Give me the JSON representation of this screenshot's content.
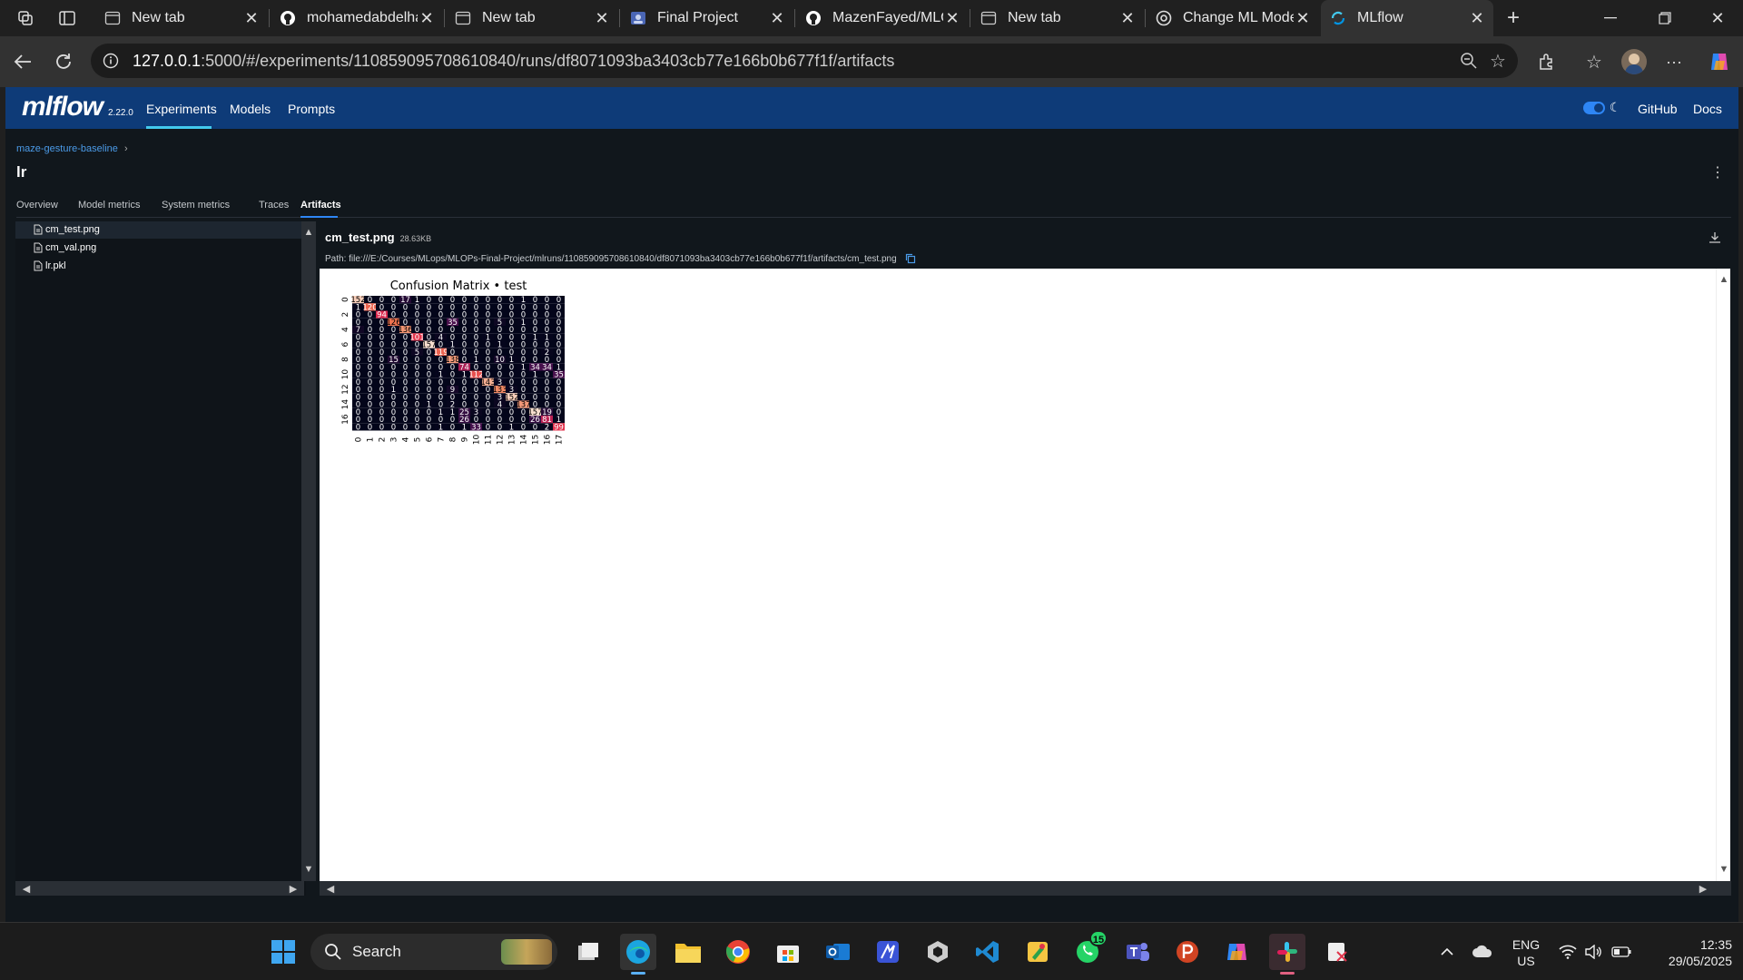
{
  "browser": {
    "tabs": [
      {
        "label": "New tab",
        "icon": "newtab-icon"
      },
      {
        "label": "mohamedabdelhamid",
        "icon": "github-icon"
      },
      {
        "label": "New tab",
        "icon": "newtab-icon"
      },
      {
        "label": "Final Project",
        "icon": "drive-icon"
      },
      {
        "label": "MazenFayed/MLOps",
        "icon": "github-icon"
      },
      {
        "label": "New tab",
        "icon": "newtab-icon"
      },
      {
        "label": "Change ML Model",
        "icon": "chatgpt-icon"
      },
      {
        "label": "MLflow",
        "icon": "mlflow-icon",
        "active": true
      }
    ],
    "url_host": "127.0.0.1",
    "url_rest": ":5000/#/experiments/110859095708610840/runs/df8071093ba3403cb77e166b0b677f1f/artifacts"
  },
  "header": {
    "logo": "mlflow",
    "version": "2.22.0",
    "nav": [
      "Experiments",
      "Models",
      "Prompts"
    ],
    "active_nav": "Experiments",
    "right_links": [
      "GitHub",
      "Docs"
    ],
    "accent": "#0e3b78"
  },
  "run": {
    "breadcrumb": "maze-gesture-baseline",
    "breadcrumb_sep": "›",
    "title": "lr",
    "tabs": [
      "Overview",
      "Model metrics",
      "System metrics",
      "Traces",
      "Artifacts"
    ],
    "active_tab": "Artifacts"
  },
  "artifacts": {
    "files": [
      "cm_test.png",
      "cm_val.png",
      "lr.pkl"
    ],
    "selected": "cm_test.png",
    "selected_size": "28.63KB",
    "path": "Path: file:///E:/Courses/MLops/MLOPs-Final-Project/mlruns/110859095708610840/df8071093ba3403cb77e166b0b677f1f/artifacts/cm_test.png"
  },
  "chart_data": {
    "type": "heatmap",
    "title": "Confusion Matrix • test",
    "x_labels": [
      "0",
      "1",
      "2",
      "3",
      "4",
      "5",
      "6",
      "7",
      "8",
      "9",
      "10",
      "11",
      "12",
      "13",
      "14",
      "15",
      "16",
      "17"
    ],
    "y_tick_labels": [
      "0",
      "",
      "2",
      "",
      "4",
      "",
      "6",
      "",
      "8",
      "",
      "10",
      "",
      "12",
      "",
      "14",
      "",
      "16",
      ""
    ],
    "matrix": [
      [
        152,
        0,
        0,
        0,
        17,
        1,
        0,
        0,
        0,
        0,
        0,
        0,
        0,
        0,
        1,
        0,
        0,
        0
      ],
      [
        1,
        120,
        0,
        0,
        0,
        0,
        0,
        0,
        0,
        0,
        0,
        0,
        0,
        0,
        0,
        0,
        0,
        0
      ],
      [
        0,
        0,
        94,
        0,
        0,
        0,
        0,
        0,
        0,
        0,
        0,
        0,
        0,
        0,
        0,
        0,
        0,
        0
      ],
      [
        0,
        0,
        0,
        126,
        0,
        0,
        0,
        0,
        35,
        0,
        0,
        0,
        5,
        0,
        1,
        0,
        0,
        0
      ],
      [
        7,
        0,
        0,
        0,
        136,
        0,
        0,
        0,
        0,
        0,
        0,
        0,
        0,
        0,
        0,
        0,
        0,
        0
      ],
      [
        0,
        0,
        0,
        0,
        0,
        101,
        0,
        4,
        0,
        0,
        0,
        1,
        0,
        0,
        0,
        1,
        1,
        0
      ],
      [
        0,
        0,
        0,
        0,
        0,
        0,
        157,
        0,
        1,
        0,
        0,
        0,
        1,
        0,
        0,
        0,
        0,
        0
      ],
      [
        0,
        0,
        0,
        0,
        0,
        5,
        0,
        119,
        0,
        0,
        0,
        0,
        0,
        0,
        0,
        0,
        2,
        0
      ],
      [
        0,
        0,
        0,
        15,
        0,
        0,
        0,
        0,
        138,
        0,
        1,
        0,
        10,
        1,
        0,
        0,
        0,
        0
      ],
      [
        0,
        0,
        0,
        0,
        0,
        0,
        0,
        0,
        0,
        74,
        0,
        0,
        0,
        0,
        1,
        34,
        34,
        1
      ],
      [
        0,
        0,
        0,
        0,
        0,
        0,
        0,
        1,
        0,
        1,
        112,
        0,
        0,
        0,
        0,
        1,
        0,
        35
      ],
      [
        0,
        0,
        0,
        0,
        0,
        0,
        0,
        0,
        0,
        0,
        0,
        143,
        3,
        0,
        0,
        0,
        0,
        0
      ],
      [
        0,
        0,
        0,
        1,
        0,
        0,
        0,
        0,
        9,
        0,
        0,
        0,
        133,
        3,
        0,
        0,
        0,
        0
      ],
      [
        0,
        0,
        0,
        0,
        0,
        0,
        0,
        0,
        0,
        0,
        0,
        0,
        3,
        152,
        0,
        0,
        0,
        0
      ],
      [
        0,
        0,
        0,
        0,
        0,
        0,
        1,
        0,
        2,
        0,
        0,
        0,
        4,
        0,
        137,
        0,
        0,
        0
      ],
      [
        0,
        0,
        0,
        0,
        0,
        0,
        0,
        1,
        1,
        25,
        3,
        0,
        0,
        0,
        0,
        157,
        19,
        0
      ],
      [
        0,
        0,
        0,
        0,
        0,
        0,
        0,
        0,
        0,
        26,
        0,
        0,
        0,
        0,
        0,
        26,
        81,
        1
      ],
      [
        0,
        0,
        0,
        0,
        0,
        0,
        0,
        1,
        0,
        1,
        33,
        0,
        0,
        1,
        0,
        0,
        2,
        99
      ]
    ],
    "vmax": 160,
    "colormap": "rocket"
  },
  "taskbar": {
    "search": "Search",
    "lang1": "ENG",
    "lang2": "US",
    "time": "12:35",
    "date": "29/05/2025",
    "whatsapp_badge": "15"
  }
}
